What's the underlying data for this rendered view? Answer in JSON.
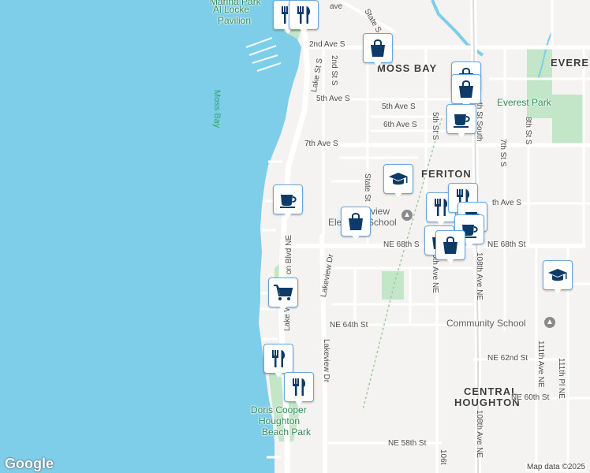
{
  "map": {
    "water_label": "Moss Bay",
    "areas": [
      "MOSS BAY",
      "FERITON",
      "CENTRAL",
      "HOUGHTON",
      "EVERES"
    ],
    "parks": [
      "Marina Park",
      "Al Locke",
      "Pavilion",
      "Everest Park",
      "Doris Cooper",
      "Houghton",
      "Beach Park"
    ],
    "schools": [
      "Elemen",
      "view",
      "School",
      "Community School"
    ],
    "streets": {
      "second_ave_s": "2nd Ave S",
      "fifth_ave_s_w": "5th Ave S",
      "fifth_ave_s_e": "5th Ave S",
      "sixth_ave_s": "6th Ave S",
      "seventh_ave_s": "7th Ave S",
      "ne68th_w": "NE 68th S",
      "ne68th_e": "NE 68th St",
      "ne64th": "NE 64th St",
      "ne62nd": "NE 62nd St",
      "ne60th": "NE 60th St",
      "ne58th": "NE 58th St",
      "th_ave_s": "th Ave S",
      "state_st_top": "State S",
      "state_st": "State St",
      "lake_st_s": "Lake St S",
      "lake_wash_blvd": "Lake W",
      "lake_wash_blvd2": "on Blvd NE",
      "lakeview_dr_n": "Lakeview Dr",
      "lakeview_dr_s": "Lakeview Dr",
      "second_st_s": "2nd St S",
      "fifth_st_s": "5th St S",
      "seventh_st_s": "7th St S",
      "eighth_st_s": "8th St S",
      "th_st_south": "th St South",
      "ave_108_s": "108th Ave NE",
      "ave_108_n": "108th Ave NE",
      "ave_106": "6th Ave NE",
      "ave_106_s": "106t",
      "ave_111": "111th Ave NE",
      "pl_111": "111th Pl NE",
      "ave_top": "ave"
    },
    "pins": [
      {
        "icon": "restaurant-icon"
      },
      {
        "icon": "restaurant-icon"
      },
      {
        "icon": "shopping-bag-icon"
      },
      {
        "icon": "shopping-bag-icon"
      },
      {
        "icon": "shopping-bag-icon"
      },
      {
        "icon": "coffee-cup-icon"
      },
      {
        "icon": "graduation-cap-icon"
      },
      {
        "icon": "coffee-cup-icon"
      },
      {
        "icon": "shopping-bag-icon"
      },
      {
        "icon": "restaurant-icon"
      },
      {
        "icon": "restaurant-icon"
      },
      {
        "icon": "coffee-cup-icon"
      },
      {
        "icon": "coffee-cup-icon"
      },
      {
        "icon": "shopping-bag-icon"
      },
      {
        "icon": "shopping-bag-icon"
      },
      {
        "icon": "shopping-cart-icon"
      },
      {
        "icon": "restaurant-icon"
      },
      {
        "icon": "restaurant-icon"
      },
      {
        "icon": "graduation-cap-icon"
      }
    ],
    "google_logo": "Google",
    "attribution": "Map data ©2025"
  }
}
